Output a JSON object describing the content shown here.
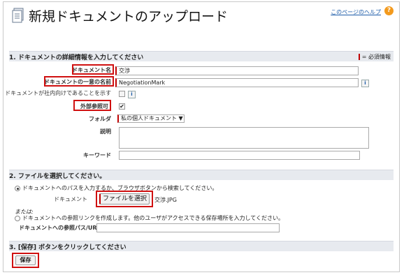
{
  "header": {
    "title": "新規ドキュメントのアップロード",
    "help_link": "このページのヘルプ",
    "help_icon": "?"
  },
  "section1": {
    "title": "1. ドキュメントの詳細情報を入力してください",
    "required_legend": "= 必須情報",
    "fields": {
      "doc_name": {
        "label": "ドキュメント名",
        "value": "交渉"
      },
      "unique_name": {
        "label": "ドキュメントの一意の名前",
        "value": "NegotiationMark"
      },
      "internal": {
        "label": "ドキュメントが社内向けであることを示す"
      },
      "external": {
        "label": "外部参照可",
        "checked": true,
        "check_mark": "✔"
      },
      "folder": {
        "label": "フォルダ",
        "value": "私の個人ドキュメント",
        "arrow": "▼"
      },
      "description": {
        "label": "説明",
        "value": ""
      },
      "keywords": {
        "label": "キーワード",
        "value": ""
      }
    },
    "info_glyph": "i"
  },
  "section2": {
    "title": "2. ファイルを選択してください。",
    "option1_text": "ドキュメントへのパスを入力するか、ブラウザボタンから検索してください。",
    "document_label": "ドキュメント",
    "file_button": "ファイルを選択",
    "file_name": "交渉.JPG",
    "or_label": "または:",
    "option2_text": "ドキュメントへの参照リンクを作成します。他のユーザがアクセスできる保存場所を入力してください。",
    "ref_label": "ドキュメントへの参照パス/URL",
    "ref_value": ""
  },
  "section3": {
    "title": "3. [保存] ボタンをクリックしてください",
    "save_button": "保存"
  },
  "colors": {
    "required": "#c00000",
    "highlight": "#d01010",
    "section_bg": "#e7eaef",
    "link": "#1a5aa8"
  }
}
